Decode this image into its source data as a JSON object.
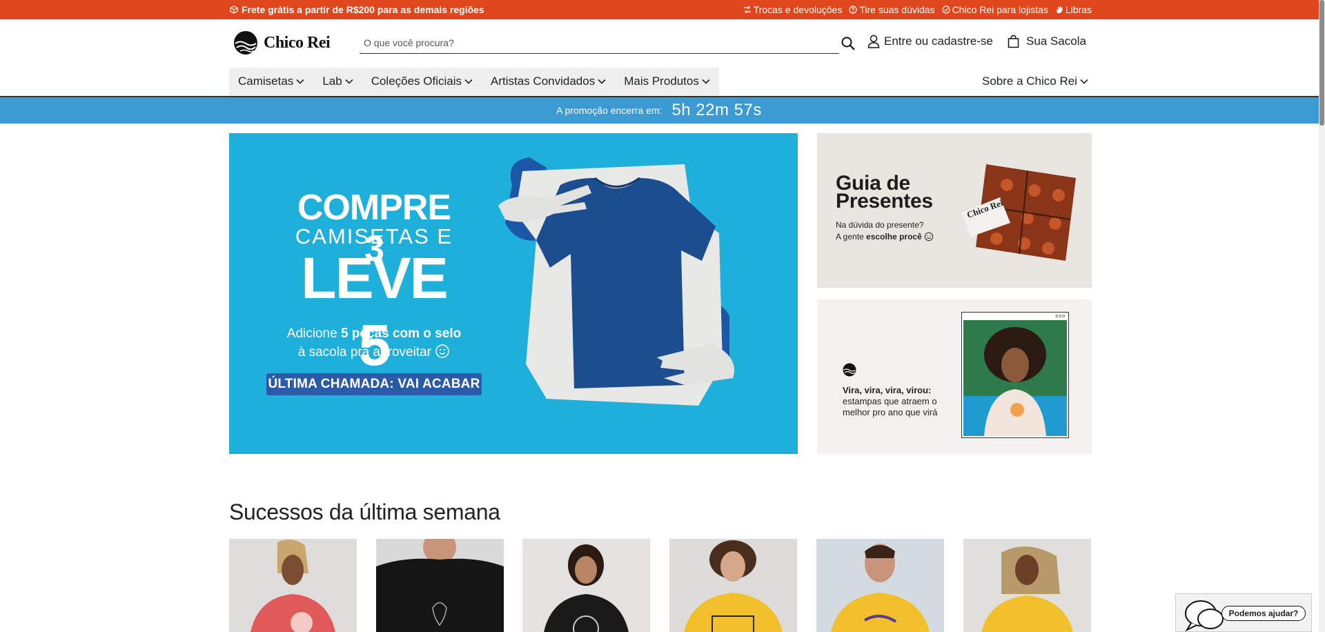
{
  "topbar": {
    "promo_text": "Frete grátis a partir de R$200 para as demais regiões",
    "links": [
      {
        "label": "Trocas e devoluções",
        "icon": "exchange-icon"
      },
      {
        "label": "Tire suas dúvidas",
        "icon": "question-icon"
      },
      {
        "label": "Chico Rei para lojistas",
        "icon": "store-icon"
      },
      {
        "label": "Libras",
        "icon": "hand-icon"
      }
    ],
    "bg_color": "#e0461c"
  },
  "header": {
    "logo_text": "Chico Rei",
    "search_placeholder": "O que você procura?",
    "account_label": "Entre ou cadastre-se",
    "bag_label": "Sua Sacola"
  },
  "nav": {
    "items": [
      {
        "label": "Camisetas"
      },
      {
        "label": "Lab"
      },
      {
        "label": "Coleções Oficiais"
      },
      {
        "label": "Artistas Convidados"
      },
      {
        "label": "Mais Produtos"
      }
    ],
    "right_item": "Sobre a Chico Rei"
  },
  "promo_bar": {
    "label": "A promoção encerra em:",
    "countdown": "5h 22m 57s",
    "bg_color": "#3b9ad2"
  },
  "hero": {
    "line1": "COMPRE 3",
    "line2": "CAMISETAS E",
    "line3": "LEVE 5",
    "desc_prefix": "Adicione ",
    "desc_bold": "5 peças com o selo",
    "desc_suffix": "à sacola pra aproveitar",
    "badge": "ÚLTIMA CHAMADA: VAI ACABAR",
    "bg_color": "#1eafdb"
  },
  "gift_card": {
    "title_line1": "Guia de",
    "title_line2": "Presentes",
    "subtitle_line1": "Na dúvida do presente?",
    "subtitle_prefix": "A gente ",
    "subtitle_bold": "escolhe procê",
    "tag_text": "Chico Rei"
  },
  "vira_card": {
    "bold_text": "Vira, vira, vira, virou:",
    "text": "estampas que atraem o melhor pro ano que virá",
    "frame_dots": "ooo"
  },
  "section": {
    "title": "Sucessos da última semana"
  },
  "help_widget": {
    "label": "Podemos ajudar?"
  }
}
